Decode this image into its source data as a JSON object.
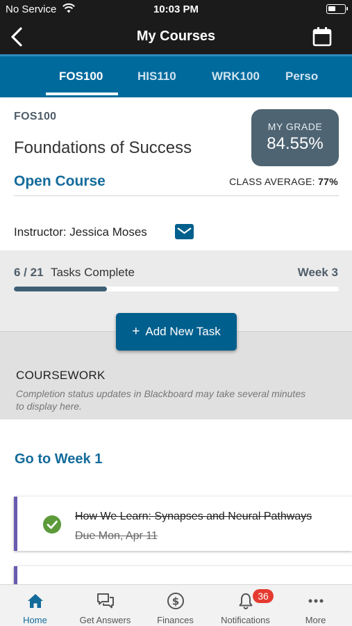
{
  "status_bar": {
    "carrier": "No Service",
    "time": "10:03 PM"
  },
  "nav": {
    "title": "My Courses"
  },
  "tabs": [
    {
      "label": "FOS100",
      "active": true
    },
    {
      "label": "HIS110",
      "active": false
    },
    {
      "label": "WRK100",
      "active": false
    },
    {
      "label": "Perso",
      "active": false
    }
  ],
  "course": {
    "code": "FOS100",
    "name": "Foundations of Success",
    "open_label": "Open Course",
    "grade_label": "MY GRADE",
    "grade_value": "84.55%",
    "class_avg_label": "CLASS AVERAGE:",
    "class_avg_value": "77%",
    "instructor": "Instructor: Jessica Moses"
  },
  "progress": {
    "count": "6 / 21",
    "label": "Tasks Complete",
    "week": "Week 3",
    "completed": 6,
    "total": 21
  },
  "add_task_label": "Add New Task",
  "coursework": {
    "title": "COURSEWORK",
    "note": "Completion status updates in Blackboard may take several minutes to display here."
  },
  "goto_week": "Go to Week 1",
  "tasks": [
    {
      "title": "How We Learn: Synapses and Neural Pathways",
      "due": "Due Mon, Apr 11",
      "completed": true
    }
  ],
  "bottom_nav": [
    {
      "label": "Home",
      "icon": "home-icon",
      "active": true
    },
    {
      "label": "Get Answers",
      "icon": "chat-icon",
      "active": false
    },
    {
      "label": "Finances",
      "icon": "dollar-icon",
      "active": false
    },
    {
      "label": "Notifications",
      "icon": "bell-icon",
      "active": false
    },
    {
      "label": "More",
      "icon": "more-icon",
      "active": false
    }
  ],
  "notifications_badge": "36",
  "colors": {
    "accent": "#006a9d",
    "header": "#1b1b1b",
    "grade_box": "#4f6472",
    "task_border": "#6a5ab0",
    "check": "#5c9a3a",
    "badge": "#e53a30"
  }
}
